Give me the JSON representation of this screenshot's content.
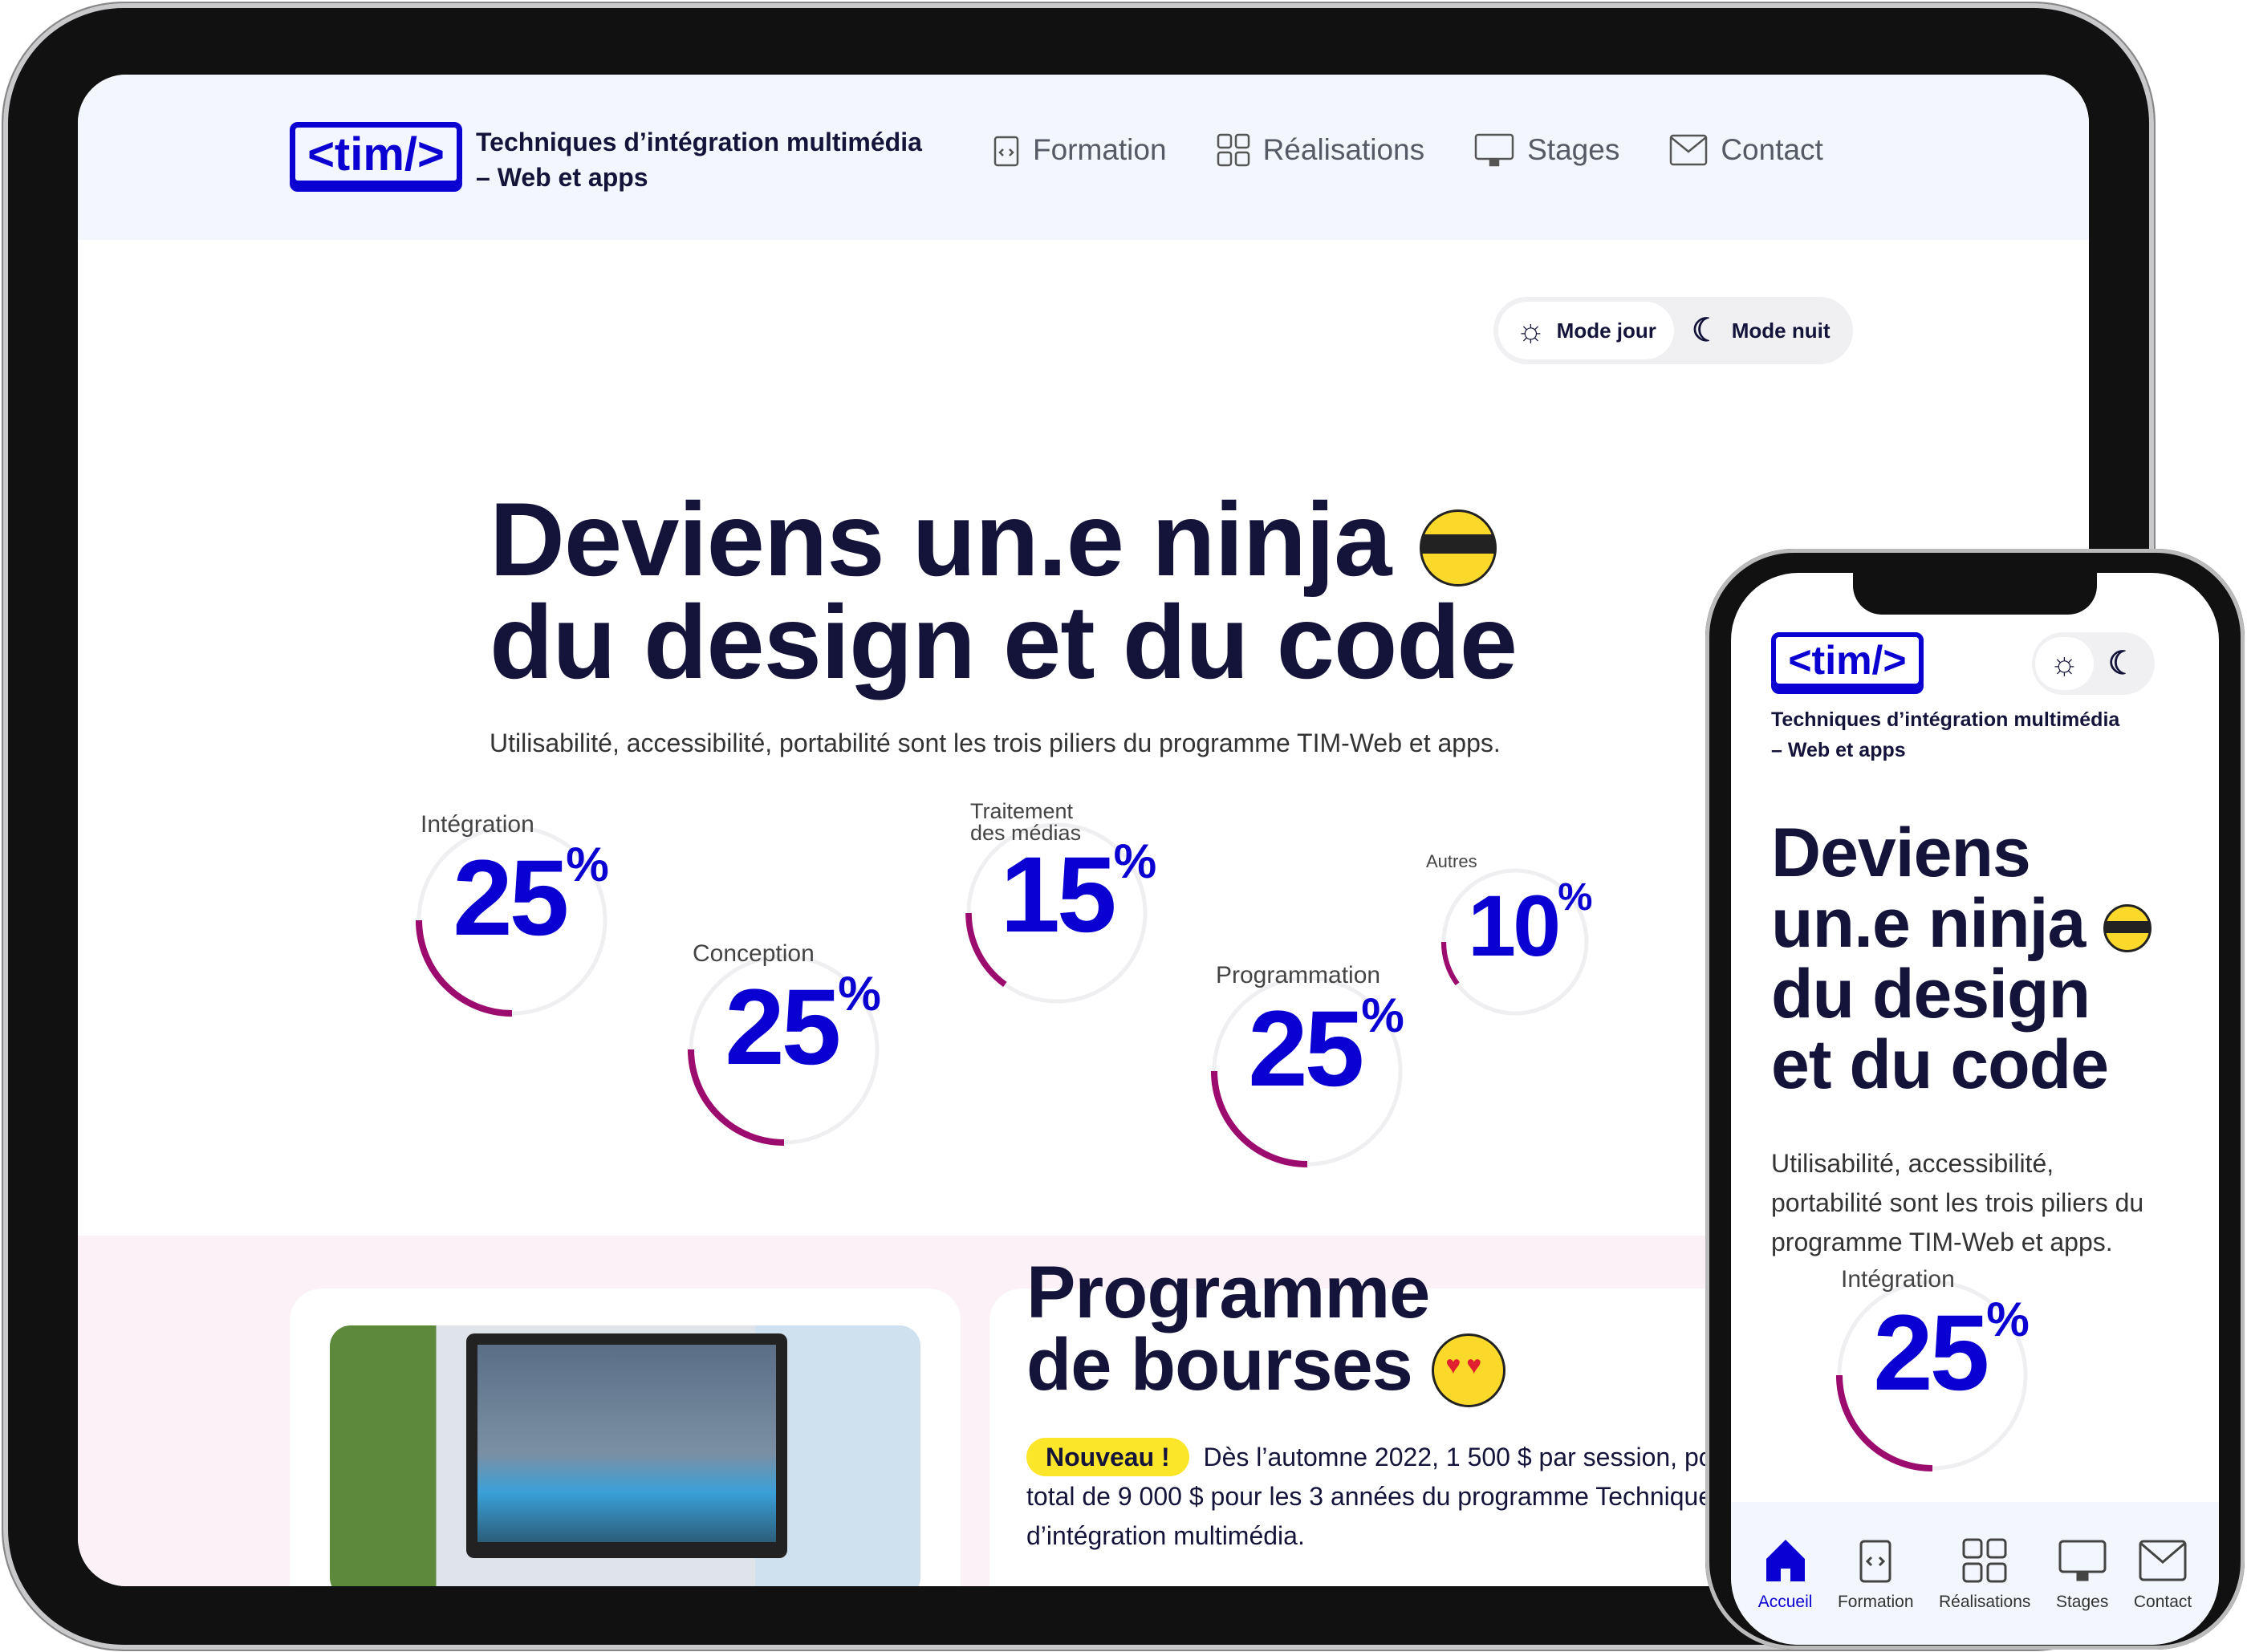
{
  "colors": {
    "brand": "#0a00d1",
    "accent_arc": "#9b0c6e",
    "text": "#14143a",
    "badge": "#fbe62a"
  },
  "desktop": {
    "logo": "<tim/>",
    "site_title_line1": "Techniques d’intégration multimédia",
    "site_title_line2": "– Web et apps",
    "nav": [
      {
        "label": "Formation",
        "icon": "clipboard-code-icon"
      },
      {
        "label": "Réalisations",
        "icon": "grid-icon"
      },
      {
        "label": "Stages",
        "icon": "monitor-icon"
      },
      {
        "label": "Contact",
        "icon": "envelope-icon"
      }
    ],
    "mode_day": "Mode jour",
    "mode_night": "Mode nuit",
    "headline_line1": "Deviens un.e ninja",
    "headline_line2": "du design et du code",
    "subtitle": "Utilisabilité, accessibilité, portabilité sont les trois piliers du programme TIM-Web et apps.",
    "stats": [
      {
        "label": "Intégration",
        "value": 25
      },
      {
        "label": "Conception",
        "value": 25
      },
      {
        "label": "Traitement des médias",
        "value": 15
      },
      {
        "label": "Programmation",
        "value": 25
      },
      {
        "label": "Autres",
        "value": 10
      }
    ],
    "percent_sign": "%",
    "bourses_title_line1": "Programme",
    "bourses_title_line2": "de bourses",
    "badge": "Nouveau !",
    "bourses_text_line1": "Dès l’automne 2022, 1 500 $ par session, pour un",
    "bourses_text_line2": "total de 9 000 $ pour les 3 années du programme Techniques",
    "bourses_text_line3": "d’intégration multimédia."
  },
  "mobile": {
    "logo": "<tim/>",
    "site_title_line1": "Techniques d’intégration multimédia",
    "site_title_line2": "– Web et apps",
    "headline": [
      "Deviens",
      "un.e ninja",
      "du design",
      "et du code"
    ],
    "subtitle": [
      "Utilisabilité, accessibilité,",
      "portabilité sont les trois piliers du",
      "programme TIM-Web et apps."
    ],
    "stat": {
      "label": "Intégration",
      "value": 25
    },
    "bottom_nav": [
      {
        "label": "Accueil",
        "icon": "home-icon",
        "active": true
      },
      {
        "label": "Formation",
        "icon": "clipboard-code-icon"
      },
      {
        "label": "Réalisations",
        "icon": "grid-icon"
      },
      {
        "label": "Stages",
        "icon": "monitor-icon"
      },
      {
        "label": "Contact",
        "icon": "envelope-icon"
      }
    ]
  }
}
